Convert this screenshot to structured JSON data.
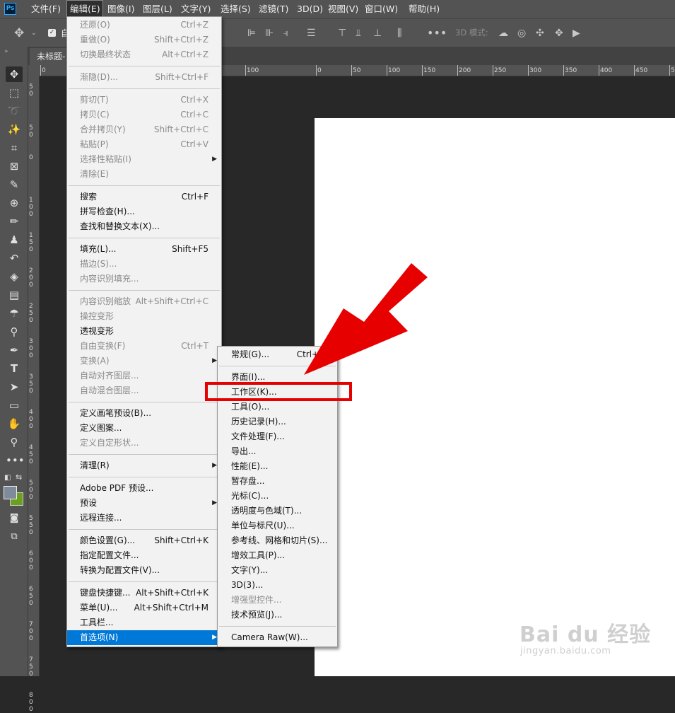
{
  "menubar": {
    "logo": "Ps",
    "items": [
      "文件(F)",
      "编辑(E)",
      "图像(I)",
      "图层(L)",
      "文字(Y)",
      "选择(S)",
      "滤镜(T)",
      "3D(D)",
      "视图(V)",
      "窗口(W)",
      "帮助(H)"
    ],
    "active_index": 1
  },
  "options_bar": {
    "tool_icon": "move-icon",
    "checkbox_label": "自",
    "mode_label": "3D 模式:"
  },
  "document": {
    "tab_title": "未标题-"
  },
  "rulers": {
    "horizontal": [
      "0",
      "100",
      "0",
      "50",
      "100",
      "150",
      "200",
      "250",
      "300",
      "350",
      "400",
      "450",
      "50"
    ],
    "vertical": [
      "5\n0",
      "5\n0",
      "0",
      "1\n0\n0",
      "1\n5\n0",
      "2\n0\n0",
      "2\n5\n0",
      "3\n0\n0",
      "3\n5\n0",
      "4\n0\n0",
      "4\n5\n0",
      "5\n0\n0",
      "5\n5\n0",
      "6\n0\n0",
      "6\n5\n0",
      "7\n0\n0",
      "7\n5\n0",
      "8\n0\n0"
    ]
  },
  "edit_menu": {
    "items": [
      {
        "label": "还原(O)",
        "shortcut": "Ctrl+Z",
        "disabled": true
      },
      {
        "label": "重做(O)",
        "shortcut": "Shift+Ctrl+Z",
        "disabled": true
      },
      {
        "label": "切换最终状态",
        "shortcut": "Alt+Ctrl+Z",
        "disabled": true
      },
      {
        "sep": true
      },
      {
        "label": "渐隐(D)...",
        "shortcut": "Shift+Ctrl+F",
        "disabled": true
      },
      {
        "sep": true
      },
      {
        "label": "剪切(T)",
        "shortcut": "Ctrl+X",
        "disabled": true
      },
      {
        "label": "拷贝(C)",
        "shortcut": "Ctrl+C",
        "disabled": true
      },
      {
        "label": "合并拷贝(Y)",
        "shortcut": "Shift+Ctrl+C",
        "disabled": true
      },
      {
        "label": "粘贴(P)",
        "shortcut": "Ctrl+V",
        "disabled": true
      },
      {
        "label": "选择性粘贴(I)",
        "shortcut": "",
        "disabled": true,
        "submenu": true
      },
      {
        "label": "清除(E)",
        "shortcut": "",
        "disabled": true
      },
      {
        "sep": true
      },
      {
        "label": "搜索",
        "shortcut": "Ctrl+F",
        "disabled": false
      },
      {
        "label": "拼写检查(H)...",
        "shortcut": "",
        "disabled": false
      },
      {
        "label": "查找和替换文本(X)...",
        "shortcut": "",
        "disabled": false
      },
      {
        "sep": true
      },
      {
        "label": "填充(L)...",
        "shortcut": "Shift+F5",
        "disabled": false
      },
      {
        "label": "描边(S)...",
        "shortcut": "",
        "disabled": true
      },
      {
        "label": "内容识别填充...",
        "shortcut": "",
        "disabled": true
      },
      {
        "sep": true
      },
      {
        "label": "内容识别缩放",
        "shortcut": "Alt+Shift+Ctrl+C",
        "disabled": true
      },
      {
        "label": "操控变形",
        "shortcut": "",
        "disabled": true
      },
      {
        "label": "透视变形",
        "shortcut": "",
        "disabled": false
      },
      {
        "label": "自由变换(F)",
        "shortcut": "Ctrl+T",
        "disabled": true
      },
      {
        "label": "变换(A)",
        "shortcut": "",
        "disabled": true,
        "submenu": true
      },
      {
        "label": "自动对齐图层...",
        "shortcut": "",
        "disabled": true
      },
      {
        "label": "自动混合图层...",
        "shortcut": "",
        "disabled": true
      },
      {
        "sep": true
      },
      {
        "label": "定义画笔预设(B)...",
        "shortcut": "",
        "disabled": false
      },
      {
        "label": "定义图案...",
        "shortcut": "",
        "disabled": false
      },
      {
        "label": "定义自定形状...",
        "shortcut": "",
        "disabled": true
      },
      {
        "sep": true
      },
      {
        "label": "清理(R)",
        "shortcut": "",
        "disabled": false,
        "submenu": true
      },
      {
        "sep": true
      },
      {
        "label": "Adobe PDF 预设...",
        "shortcut": "",
        "disabled": false
      },
      {
        "label": "预设",
        "shortcut": "",
        "disabled": false,
        "submenu": true
      },
      {
        "label": "远程连接...",
        "shortcut": "",
        "disabled": false
      },
      {
        "sep": true
      },
      {
        "label": "颜色设置(G)...",
        "shortcut": "Shift+Ctrl+K",
        "disabled": false
      },
      {
        "label": "指定配置文件...",
        "shortcut": "",
        "disabled": false
      },
      {
        "label": "转换为配置文件(V)...",
        "shortcut": "",
        "disabled": false
      },
      {
        "sep": true
      },
      {
        "label": "键盘快捷键...",
        "shortcut": "Alt+Shift+Ctrl+K",
        "disabled": false
      },
      {
        "label": "菜单(U)...",
        "shortcut": "Alt+Shift+Ctrl+M",
        "disabled": false
      },
      {
        "label": "工具栏...",
        "shortcut": "",
        "disabled": false
      },
      {
        "label": "首选项(N)",
        "shortcut": "",
        "disabled": false,
        "submenu": true,
        "highlight": true
      }
    ]
  },
  "preferences_submenu": {
    "items": [
      {
        "label": "常规(G)...",
        "shortcut": "Ctrl+K",
        "disabled": false
      },
      {
        "sep": true
      },
      {
        "label": "界面(I)...",
        "disabled": false
      },
      {
        "label": "工作区(K)...",
        "disabled": false,
        "boxed": true
      },
      {
        "label": "工具(O)...",
        "disabled": false
      },
      {
        "label": "历史记录(H)...",
        "disabled": false
      },
      {
        "label": "文件处理(F)...",
        "disabled": false
      },
      {
        "label": "导出...",
        "disabled": false
      },
      {
        "label": "性能(E)...",
        "disabled": false
      },
      {
        "label": "暂存盘...",
        "disabled": false
      },
      {
        "label": "光标(C)...",
        "disabled": false
      },
      {
        "label": "透明度与色域(T)...",
        "disabled": false
      },
      {
        "label": "单位与标尺(U)...",
        "disabled": false
      },
      {
        "label": "参考线、网格和切片(S)...",
        "disabled": false
      },
      {
        "label": "增效工具(P)...",
        "disabled": false
      },
      {
        "label": "文字(Y)...",
        "disabled": false
      },
      {
        "label": "3D(3)...",
        "disabled": false
      },
      {
        "label": "增强型控件...",
        "disabled": true
      },
      {
        "label": "技术预览(J)...",
        "disabled": false
      },
      {
        "sep": true
      },
      {
        "label": "Camera Raw(W)...",
        "disabled": false
      }
    ]
  },
  "colors": {
    "highlight": "#0078d7",
    "annotation_red": "#e60000",
    "foreground_swatch": "#7f8a9a",
    "background_swatch": "#6aa01e"
  },
  "watermark": {
    "logo": "Bai du 经验",
    "url": "jingyan.baidu.com"
  }
}
